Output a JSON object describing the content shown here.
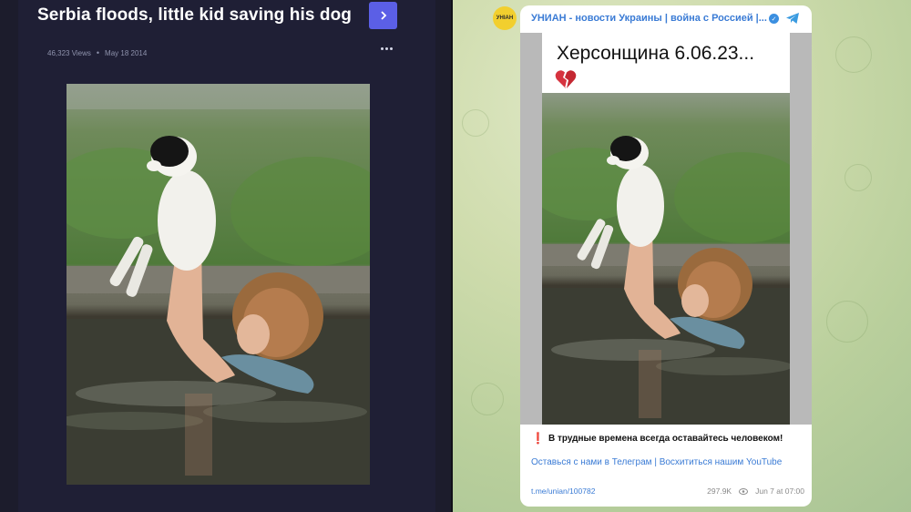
{
  "left": {
    "title": "Serbia floods, little kid saving his dog",
    "views": "46,323 Views",
    "date": "May 18 2014",
    "next_button": "›",
    "more_icon": "more-horizontal-icon"
  },
  "right": {
    "channel": "УНИАН - новости Украины | война с Россией |...",
    "avatar_text": "УНІАН",
    "caption": "Херсонщина 6.06.23...",
    "caption_emoji": "broken-heart-icon",
    "message_exclaim": "❗",
    "message": "В трудные времена всегда оставайтесь человеком!",
    "links": "Оставься с нами в Телеграм | Восхититься нашим YouTube",
    "post_link": "t.me/unian/100782",
    "views": "297.9K",
    "date": "Jun 7 at 07:00"
  },
  "colors": {
    "left_bg": "#1f1f35",
    "accent_button": "#5b5fe6",
    "telegram_link": "#3a7bd5",
    "chat_bg": "#cfdcad"
  }
}
